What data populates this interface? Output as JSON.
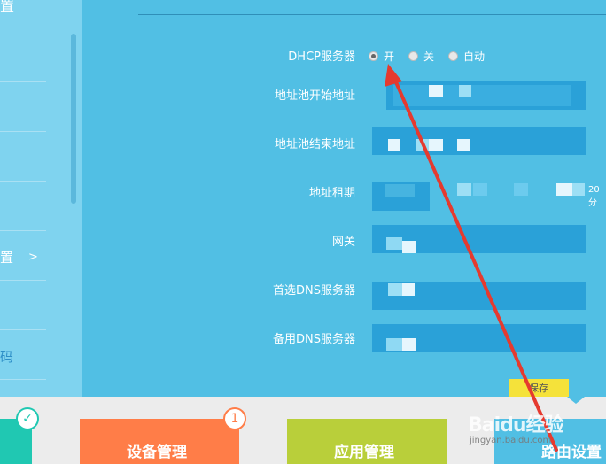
{
  "sidebar": {
    "title_fragment": "置",
    "chevron": ">",
    "item_fragment": "置",
    "password_fragment": "码"
  },
  "form": {
    "dhcp_label": "DHCP服务器",
    "options": [
      {
        "label": "开",
        "checked": true
      },
      {
        "label": "关",
        "checked": false
      },
      {
        "label": "自动",
        "checked": false
      }
    ],
    "pool_start_label": "地址池开始地址",
    "pool_end_label": "地址池结束地址",
    "lease_label": "地址租期",
    "lease_suffix": "20分",
    "gateway_label": "网关",
    "primary_dns_label": "首选DNS服务器",
    "secondary_dns_label": "备用DNS服务器",
    "save_label": "保存"
  },
  "tabs": [
    {
      "label": "设备管理",
      "badge": "1",
      "color": "#ff7d48"
    },
    {
      "label": "应用管理",
      "color": "#b9cf3a"
    },
    {
      "label": "路由设置",
      "color": "#51bfe4"
    }
  ],
  "watermark": {
    "brand": "Baidu经验",
    "url": "jingyan.baidu.com"
  },
  "colors": {
    "main_bg": "#51bfe4",
    "field_bg": "#2aa1d8",
    "sidebar_bg": "#7fd3ef",
    "save_bg": "#f5e23a",
    "arrow": "#e53a2f"
  }
}
